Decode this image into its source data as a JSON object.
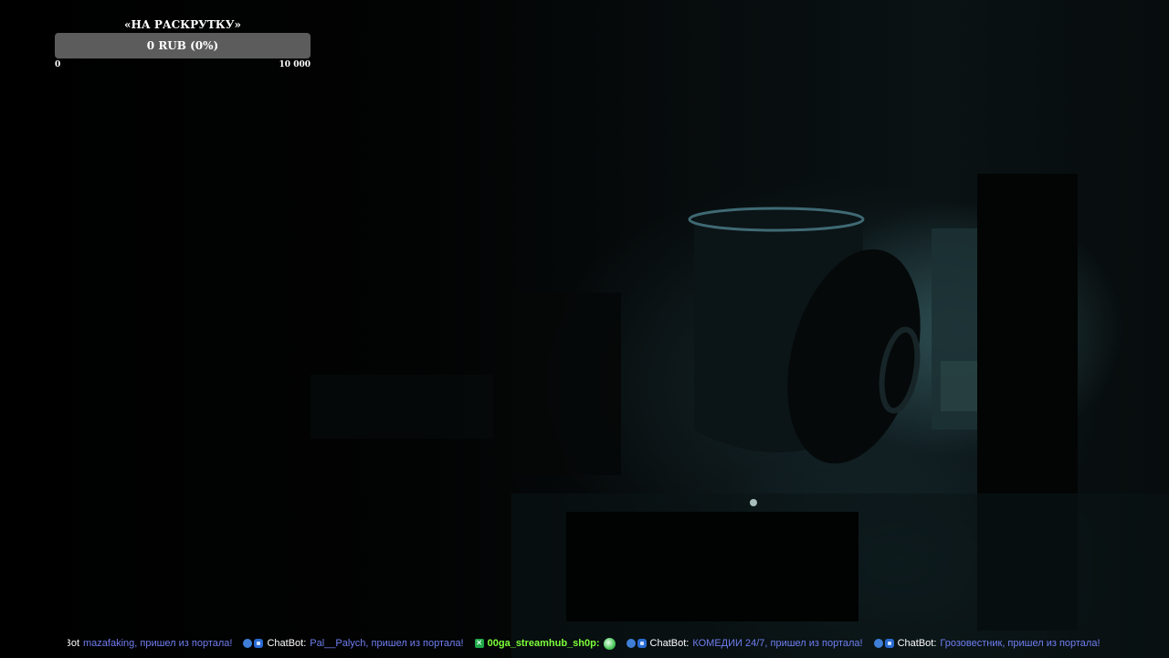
{
  "goal": {
    "title": "«НА РАСКРУТКУ»",
    "amount": "0 RUB (0%)",
    "progress_percent": 0,
    "min_label": "0",
    "max_label": "10 000"
  },
  "chat": {
    "messages": [
      {
        "author": "ChatBot:",
        "text": "mazafaking, пришел из портала!"
      },
      {
        "author": "ChatBot:",
        "text": "Pal__Palych, пришел из портала!"
      },
      {
        "author": "00ga_streamhub_sh0p:",
        "text": ""
      },
      {
        "author": "ChatBot:",
        "text": "КОМЕДИИ 24/7, пришел из портала!"
      },
      {
        "author": "ChatBot:",
        "text": "Грозовестник, пришел из портала!"
      }
    ]
  },
  "colors": {
    "chat_text": "#6f7ef0",
    "author_highlight": "#7dff3a",
    "goal_bar": "#5c5c5c"
  },
  "icons": {
    "bot_badge": "bot-icon",
    "moderator_badge": "moderator-icon",
    "emote": "emote-icon"
  }
}
